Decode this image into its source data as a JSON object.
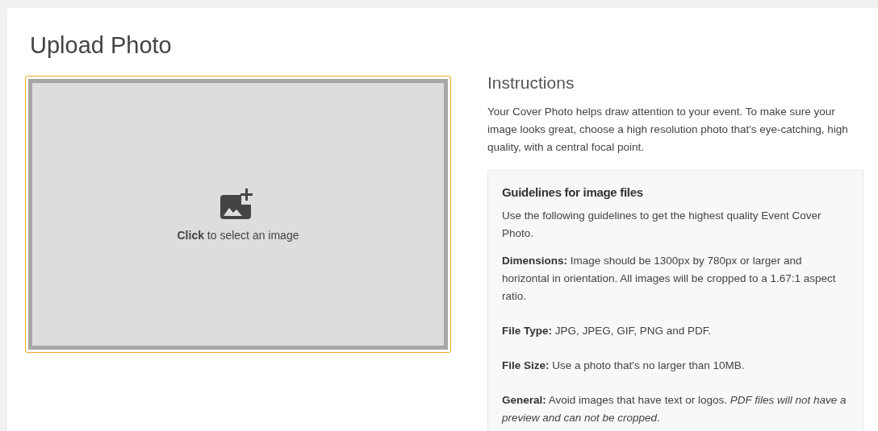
{
  "title": "Upload Photo",
  "dropzone": {
    "prompt": "**Click** to select an image",
    "focused": true
  },
  "instructions": {
    "heading": "Instructions",
    "text": "Your Cover Photo helps draw attention to your event. To make sure your image looks great, choose a high resolution photo that's eye-catching, high quality, with a central focal point."
  },
  "guidelines": {
    "heading": "Guidelines for image files",
    "intro": "Use the following guidelines to get the highest quality Event Cover Photo.",
    "items": [
      {
        "label": "Dimensions:",
        "text": "Image should be 1300px by 780px or larger and horizontal in orientation. All images will be cropped to a 1.67:1 aspect ratio."
      },
      {
        "label": "File Type:",
        "text": "JPG, JPEG, GIF, PNG and PDF."
      },
      {
        "label": "File Size:",
        "text": "Use a photo that's no larger than 10MB."
      },
      {
        "label": "General:",
        "text": "Avoid images that have text or logos. *PDF files will not have a preview and can not be cropped.*"
      }
    ]
  }
}
